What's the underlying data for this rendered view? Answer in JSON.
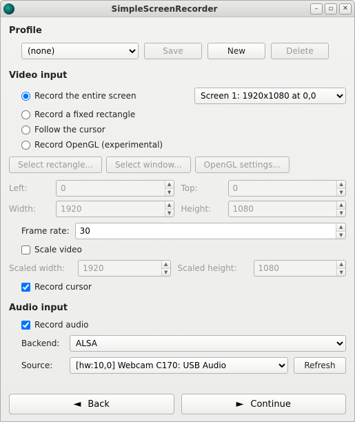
{
  "window": {
    "title": "SimpleScreenRecorder"
  },
  "profile": {
    "heading": "Profile",
    "selected": "(none)",
    "save": "Save",
    "new": "New",
    "delete": "Delete"
  },
  "video": {
    "heading": "Video input",
    "opt_entire": "Record the entire screen",
    "opt_rect": "Record a fixed rectangle",
    "opt_cursor": "Follow the cursor",
    "opt_opengl": "Record OpenGL (experimental)",
    "screen_selected": "Screen 1: 1920x1080 at 0,0",
    "btn_select_rect": "Select rectangle...",
    "btn_select_win": "Select window...",
    "btn_opengl": "OpenGL settings...",
    "left_label": "Left:",
    "left": "0",
    "top_label": "Top:",
    "top": "0",
    "width_label": "Width:",
    "width": "1920",
    "height_label": "Height:",
    "height": "1080",
    "framerate_label": "Frame rate:",
    "framerate": "30",
    "scale_label": "Scale video",
    "scaled_w_label": "Scaled width:",
    "scaled_w": "1920",
    "scaled_h_label": "Scaled height:",
    "scaled_h": "1080",
    "record_cursor_label": "Record cursor"
  },
  "audio": {
    "heading": "Audio input",
    "record_label": "Record audio",
    "backend_label": "Backend:",
    "backend": "ALSA",
    "source_label": "Source:",
    "source": "[hw:10,0] Webcam C170: USB Audio",
    "refresh": "Refresh"
  },
  "nav": {
    "back": "Back",
    "continue": "Continue"
  }
}
